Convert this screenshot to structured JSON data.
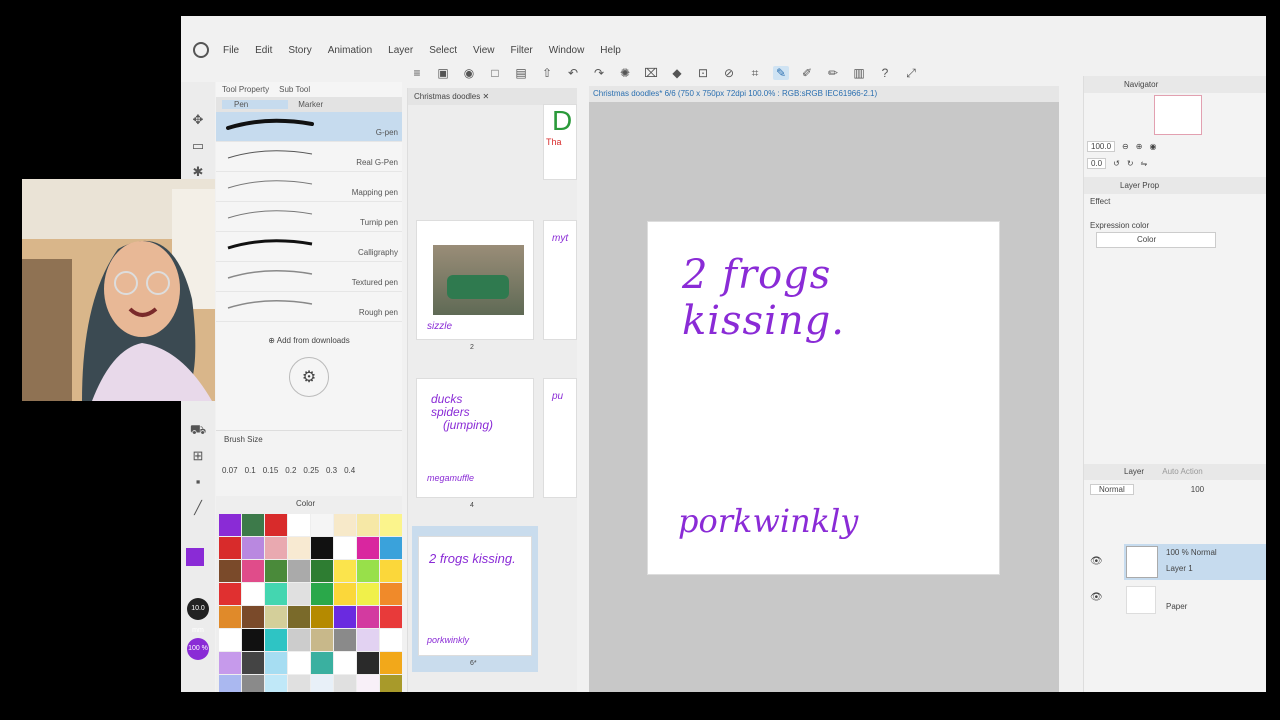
{
  "menu": [
    "File",
    "Edit",
    "Story",
    "Animation",
    "Layer",
    "Select",
    "View",
    "Filter",
    "Window",
    "Help"
  ],
  "tool_property": {
    "tabs": [
      "Tool Property",
      "Sub Tool"
    ],
    "subtabs": [
      "Pen",
      "Marker"
    ],
    "pens": [
      "G-pen",
      "Real G-Pen",
      "Mapping pen",
      "Turnip pen",
      "Calligraphy",
      "Textured pen",
      "Rough pen"
    ],
    "add_from_downloads": "Add from downloads"
  },
  "brush_size": {
    "title": "Brush Size",
    "values": [
      "0.07",
      "0.1",
      "0.15",
      "0.2",
      "0.25",
      "0.3",
      "0.4"
    ]
  },
  "color_panel": {
    "title": "Color"
  },
  "left_badges": {
    "size": "10.0\nmm",
    "opacity": "100\n%"
  },
  "pages_panel": {
    "tab": "Christmas doodles",
    "page2": {
      "text": "sizzle",
      "num": "2"
    },
    "page3": {
      "lines": [
        "ducks",
        "spiders",
        "(jumping)"
      ],
      "footer": "megamuffle",
      "num": "4"
    },
    "page6": {
      "title": "2 frogs kissing.",
      "footer": "porkwinkly",
      "num": "6*"
    }
  },
  "canvas": {
    "title_bar": "Christmas doodles* 6/6 (750 x 750px 72dpi 100.0% : RGB:sRGB IEC61966-2.1)",
    "heading": "2 frogs kissing.",
    "footer": "porkwinkly"
  },
  "navigator": {
    "title": "Navigator",
    "zoom": "100.0",
    "angle": "0.0"
  },
  "layer_property": {
    "title": "Layer Prop",
    "effect": "Effect",
    "expression_label": "Expression color",
    "expression_value": "Color"
  },
  "layers": {
    "title": "Layer",
    "auto_action": "Auto Action",
    "blend": "Normal",
    "opacity": "100",
    "items": [
      {
        "mode": "100 % Normal",
        "name": "Layer 1"
      },
      {
        "mode": "",
        "name": "Paper"
      }
    ]
  },
  "colors": {
    "accent": "#8a2bd6",
    "purple_ink": "#8a2bd6",
    "selection": "#c6dbee"
  },
  "palette": [
    "#8a2bd6",
    "#3d7a4a",
    "#d82b2b",
    "#ffffff",
    "#f5f5f5",
    "#f7e9c9",
    "#f6e8a6",
    "#fbf48c",
    "#d82b2b",
    "#b988e0",
    "#e9a9b0",
    "#f8ead2",
    "#111111",
    "#ffffff",
    "#d9269f",
    "#3aa2db",
    "#7a4a2a",
    "#e04c8a",
    "#4a8a3a",
    "#aaaaaa",
    "#2e7d32",
    "#fbe44c",
    "#98e04a",
    "#fbd73a",
    "#e03030",
    "#ffffff",
    "#44d6b0",
    "#e0e0e0",
    "#2aa84a",
    "#fbd73a",
    "#f0f04a",
    "#f08a2a",
    "#e08a2a",
    "#7a4a2a",
    "#d4cf9a",
    "#7a6a2a",
    "#b58a00",
    "#6a2ae0",
    "#d33aa0",
    "#e83a3a",
    "#ffffff",
    "#111111",
    "#2ec4c4",
    "#cccccc",
    "#c8b88a",
    "#8a8a8a",
    "#e2d2f2",
    "#ffffff",
    "#c69aeb",
    "#444444",
    "#a6ddf2",
    "#ffffff",
    "#3ab0a0",
    "#ffffff",
    "#2a2a2a",
    "#f2a81a",
    "#aab8f0",
    "#8a8a8a",
    "#c0e8f8",
    "#e0e0e0",
    "#e8f0f8",
    "#e0e0e0",
    "#f8f0f8",
    "#a89a2a"
  ]
}
